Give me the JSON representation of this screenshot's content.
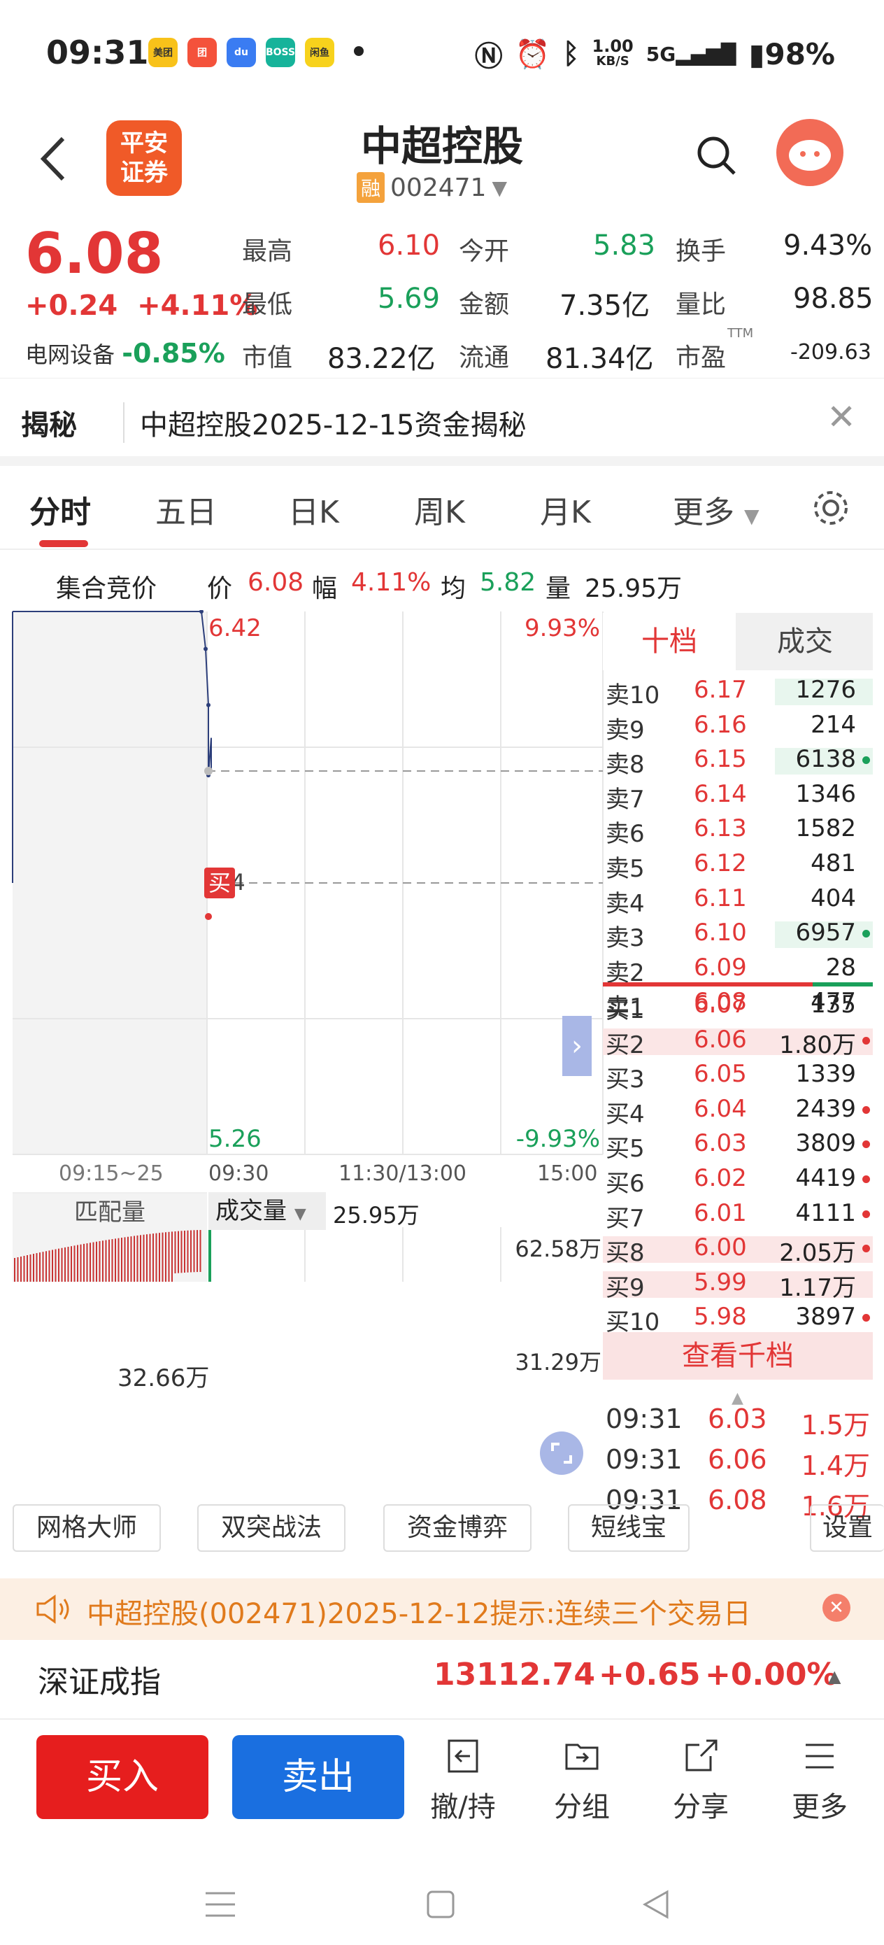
{
  "status": {
    "time": "09:31",
    "net_speed": "1.00",
    "net_unit": "KB/S",
    "signal": "5G",
    "battery": "98%"
  },
  "header": {
    "stock_name": "中超控股",
    "rong": "融",
    "code": "002471"
  },
  "quote": {
    "price": "6.08",
    "change": "+0.24",
    "change_pct": "+4.11%",
    "sector_name": "电网设备",
    "sector_pct": "-0.85%",
    "high_label": "最高",
    "high": "6.10",
    "open_label": "今开",
    "open": "5.83",
    "turnover_label": "换手",
    "turnover": "9.43%",
    "low_label": "最低",
    "low": "5.69",
    "amount_label": "金额",
    "amount": "7.35亿",
    "vol_ratio_label": "量比",
    "vol_ratio": "98.85",
    "mcap_label": "市值",
    "mcap": "83.22亿",
    "float_label": "流通",
    "float": "81.34亿",
    "pe_label": "市盈",
    "pe_sup": "TTM",
    "pe": "-209.63"
  },
  "reveal": {
    "title": "揭秘",
    "text": "中超控股2025-12-15资金揭秘"
  },
  "tabs": [
    "分时",
    "五日",
    "日K",
    "周K",
    "月K",
    "更多"
  ],
  "info": {
    "auction": "集合竞价",
    "price_label": "价",
    "price": "6.08",
    "pct_label": "幅",
    "pct": "4.11%",
    "avg_label": "均",
    "avg": "5.82",
    "vol_label": "量",
    "vol": "25.95万"
  },
  "chart": {
    "high_price": "6.42",
    "high_pct": "9.93%",
    "low_price": "5.26",
    "low_pct": "-9.93%",
    "mid_label": "84",
    "buy_tag": "买",
    "x_labels": [
      "09:15~25",
      "09:30",
      "11:30/13:00",
      "15:00"
    ],
    "match_label": "匹配量",
    "vol_select": "成交量",
    "vol_value": "25.95万",
    "vol_max": "62.58万",
    "vol_mid": "31.29万",
    "match_value": "32.66万"
  },
  "chart_data": {
    "type": "line",
    "series": [
      {
        "values": [
          6.42,
          6.42,
          6.34,
          6.22,
          6.07,
          6.15,
          6.08
        ]
      }
    ],
    "ylim": [
      5.26,
      6.42
    ]
  },
  "orderbook": {
    "tab_a": "十档",
    "tab_b": "成交",
    "asks": [
      {
        "l": "卖10",
        "p": "6.17",
        "v": "1276",
        "hl": "g"
      },
      {
        "l": "卖9",
        "p": "6.16",
        "v": "214",
        "hl": ""
      },
      {
        "l": "卖8",
        "p": "6.15",
        "v": "6138",
        "hl": "gd"
      },
      {
        "l": "卖7",
        "p": "6.14",
        "v": "1346",
        "hl": ""
      },
      {
        "l": "卖6",
        "p": "6.13",
        "v": "1582",
        "hl": ""
      },
      {
        "l": "卖5",
        "p": "6.12",
        "v": "481",
        "hl": ""
      },
      {
        "l": "卖4",
        "p": "6.11",
        "v": "404",
        "hl": ""
      },
      {
        "l": "卖3",
        "p": "6.10",
        "v": "6957",
        "hl": "gd"
      },
      {
        "l": "卖2",
        "p": "6.09",
        "v": "28",
        "hl": ""
      },
      {
        "l": "卖1",
        "p": "6.08",
        "v": "477",
        "hl": ""
      }
    ],
    "bids": [
      {
        "l": "买1",
        "p": "6.07",
        "v": "135",
        "hl": ""
      },
      {
        "l": "买2",
        "p": "6.06",
        "v": "1.80万",
        "hl": "rd"
      },
      {
        "l": "买3",
        "p": "6.05",
        "v": "1339",
        "hl": ""
      },
      {
        "l": "买4",
        "p": "6.04",
        "v": "2439",
        "hl": "d"
      },
      {
        "l": "买5",
        "p": "6.03",
        "v": "3809",
        "hl": "d"
      },
      {
        "l": "买6",
        "p": "6.02",
        "v": "4419",
        "hl": "d"
      },
      {
        "l": "买7",
        "p": "6.01",
        "v": "4111",
        "hl": "d"
      },
      {
        "l": "买8",
        "p": "6.00",
        "v": "2.05万",
        "hl": "rd"
      },
      {
        "l": "买9",
        "p": "5.99",
        "v": "1.17万",
        "hl": "r"
      },
      {
        "l": "买10",
        "p": "5.98",
        "v": "3897",
        "hl": "d"
      }
    ],
    "view_more": "查看千档",
    "trades": [
      {
        "t": "09:31",
        "p": "6.03",
        "v": "1.5万"
      },
      {
        "t": "09:31",
        "p": "6.06",
        "v": "1.4万"
      },
      {
        "t": "09:31",
        "p": "6.08",
        "v": "1.6万"
      }
    ]
  },
  "tools": [
    "网格大师",
    "双突战法",
    "资金博弈",
    "短线宝",
    "设置"
  ],
  "notice": "中超控股(002471)2025-12-12提示:连续三个交易日",
  "index": {
    "name": "深证成指",
    "value": "13112.74",
    "change": "+0.65",
    "pct": "+0.00%"
  },
  "bottom": {
    "buy": "买入",
    "sell": "卖出",
    "withdraw": "撤/持",
    "group": "分组",
    "share": "分享",
    "more": "更多"
  }
}
